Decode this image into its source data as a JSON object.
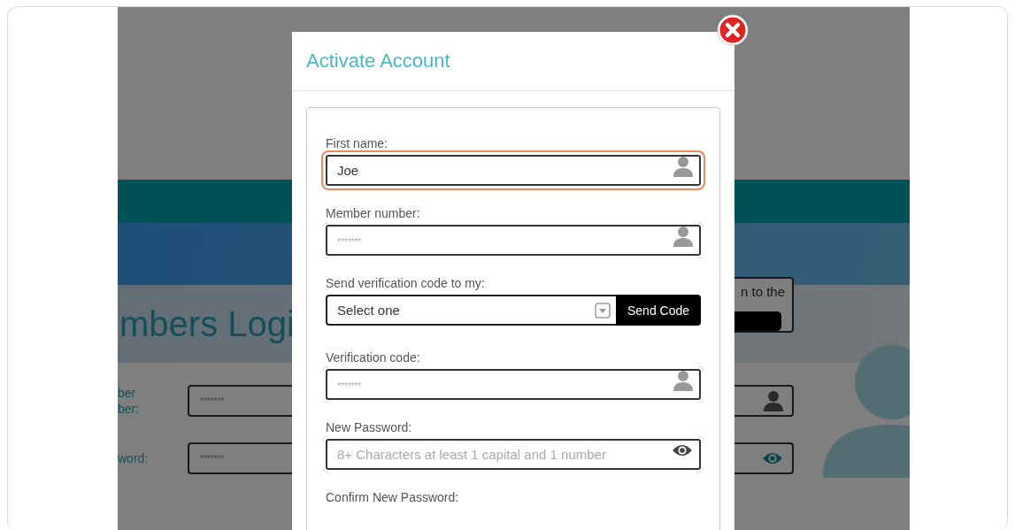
{
  "background": {
    "heading": "mbers Logi",
    "notice": {
      "text": "n to the"
    },
    "fields": [
      {
        "kind": "text",
        "label": "ber\nber:",
        "placeholder": "*******"
      },
      {
        "kind": "password",
        "label": "word:",
        "placeholder": "*******"
      }
    ]
  },
  "modal": {
    "title": "Activate Account",
    "fields": [
      {
        "kind": "text",
        "label": "First name:",
        "value": "Joe",
        "focused": true
      },
      {
        "kind": "text",
        "label": "Member number:",
        "placeholder": "*******",
        "focused": false
      },
      {
        "kind": "select",
        "label": "Send verification code to my:",
        "value": "Select one",
        "button": "Send Code"
      },
      {
        "kind": "text",
        "label": "Verification code:",
        "placeholder": "*******",
        "focused": false
      },
      {
        "kind": "password",
        "label": "New Password:",
        "placeholder": "8+ Characters at least 1 capital and 1 number",
        "focused": false
      },
      {
        "kind": "heading",
        "label": "Confirm New Password:"
      }
    ]
  }
}
